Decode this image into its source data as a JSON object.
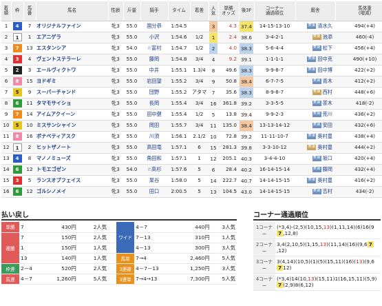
{
  "headers": [
    "着\n順",
    "枠",
    "馬\n番",
    "馬名",
    "性齢",
    "斤量",
    "騎手",
    "タイム",
    "着差",
    "人\n気",
    "単勝\nオッズ",
    "後3F",
    "コーナー\n通過順位",
    "厩舎",
    "馬体重\n(増減)"
  ],
  "frame_colors": {
    "1": "#ffffff",
    "2": "#222222",
    "3": "#e03030",
    "4": "#2a5cc8",
    "5": "#e8c51c",
    "6": "#2f9a3a",
    "7": "#f08a1c",
    "8": "#f08aa8"
  },
  "rows": [
    {
      "rank": "1",
      "waku": "4",
      "num": "7",
      "name": "オリジナルファイン",
      "sex_age": "牝3",
      "weight": "55.0",
      "jockey": "国分恭",
      "time": "1:54.5",
      "margin": "",
      "pop": "3",
      "odds": "4.3",
      "f3": "37.4",
      "corner": "14-15-13-10",
      "stable_tag": "美東",
      "trainer": "清水久",
      "body": "494(+4)"
    },
    {
      "rank": "2",
      "waku": "1",
      "num": "1",
      "name": "エアニゲラ",
      "sex_age": "牝3",
      "weight": "55.0",
      "jockey": "小沢",
      "time": "1:54.6",
      "margin": "1/2",
      "pop": "1",
      "odds": "2.4",
      "f3": "38.6",
      "corner": "3-4-2-1",
      "stable_tag": "美東",
      "trainer": "池添",
      "body": "460(-4)"
    },
    {
      "rank": "3",
      "waku": "7",
      "num": "13",
      "name": "エスタンシア",
      "sex_age": "牝3",
      "weight": "54.0",
      "jockey": "☆富村",
      "time": "1:54.7",
      "margin": "1/2",
      "pop": "2",
      "odds": "4.0",
      "f3": "38.3",
      "corner": "5-6-4-4",
      "stable_tag": "美東",
      "trainer": "松下",
      "body": "456(+4)"
    },
    {
      "rank": "4",
      "waku": "3",
      "num": "4",
      "name": "ヴェントステラーレ",
      "sex_age": "牝3",
      "weight": "55.0",
      "jockey": "藤岡",
      "time": "1:54.8",
      "margin": "3/4",
      "pop": "4",
      "odds": "9.2",
      "f3": "39.1",
      "corner": "1-1-1-1",
      "stable_tag": "美東",
      "trainer": "田中克",
      "body": "490(+10)"
    },
    {
      "rank": "5",
      "waku": "2",
      "num": "3",
      "name": "エールヴィクトワ",
      "sex_age": "牝3",
      "weight": "55.0",
      "jockey": "中井",
      "time": "1:55.1",
      "margin": "1.3/4",
      "pop": "8",
      "odds": "49.6",
      "f3": "38.3",
      "corner": "9-9-8-7",
      "stable_tag": "美東",
      "trainer": "田中博",
      "body": "422(+2)"
    },
    {
      "rank": "6",
      "waku": "8",
      "num": "15",
      "name": "ヨドギミ",
      "sex_age": "牝3",
      "weight": "55.0",
      "jockey": "岩田望",
      "time": "1:55.2",
      "margin": "3/4",
      "pop": "9",
      "odds": "50.8",
      "f3": "38.4",
      "corner": "6-7-7-5",
      "stable_tag": "美東",
      "trainer": "青木",
      "body": "412(+2)"
    },
    {
      "rank": "7",
      "waku": "5",
      "num": "9",
      "name": "スーパーチャンド",
      "sex_age": "牝3",
      "weight": "55.0",
      "jockey": "団野",
      "time": "1:55.2",
      "margin": "アタマ",
      "pop": "7",
      "odds": "35.6",
      "f3": "38.3",
      "corner": "8-9-8-7",
      "stable_tag": "美東",
      "trainer": "西村",
      "body": "448(+6)"
    },
    {
      "rank": "8",
      "waku": "6",
      "num": "11",
      "name": "タマモサイショ",
      "sex_age": "牝3",
      "weight": "55.0",
      "jockey": "長岡",
      "time": "1:55.4",
      "margin": "3/4",
      "pop": "16",
      "odds": "361.8",
      "f3": "39.2",
      "corner": "3-3-5-5",
      "stable_tag": "美東",
      "trainer": "茶木",
      "body": "418(-2)"
    },
    {
      "rank": "9",
      "waku": "7",
      "num": "14",
      "name": "アイムアクイーン",
      "sex_age": "牝3",
      "weight": "55.0",
      "jockey": "田中健",
      "time": "1:55.4",
      "margin": "1/2",
      "pop": "5",
      "odds": "13.8",
      "f3": "39.4",
      "corner": "9-9-2-3",
      "stable_tag": "美東",
      "trainer": "荒川",
      "body": "436(+2)"
    },
    {
      "rank": "10",
      "waku": "5",
      "num": "10",
      "name": "ミスサンシャイン",
      "sex_age": "牝3",
      "weight": "55.0",
      "jockey": "岡田",
      "time": "1:55.7",
      "margin": "3/4",
      "pop": "11",
      "odds": "135.0",
      "f3": "38.4",
      "corner": "13-13-14-12",
      "stable_tag": "美東",
      "trainer": "安田",
      "body": "432(+6)"
    },
    {
      "rank": "11",
      "waku": "8",
      "num": "16",
      "name": "ボナベティアスク",
      "sex_age": "牝3",
      "weight": "55.0",
      "jockey": "川須",
      "time": "1:56.1",
      "margin": "2.1/2",
      "pop": "10",
      "odds": "72.8",
      "f3": "39.2",
      "corner": "11-11-10-7",
      "stable_tag": "美東",
      "trainer": "奥村豊",
      "body": "438(+4)"
    },
    {
      "rank": "12",
      "waku": "1",
      "num": "2",
      "name": "ヒットザノート",
      "sex_age": "牝3",
      "weight": "55.0",
      "jockey": "高田竜",
      "time": "1:57.1",
      "margin": "6",
      "pop": "15",
      "odds": "281.3",
      "f3": "39.8",
      "corner": "3-3-10-12",
      "stable_tag": "美東",
      "trainer": "奥村豊",
      "body": "444(+2)"
    },
    {
      "rank": "13",
      "waku": "4",
      "num": "8",
      "name": "マノノミューズ",
      "sex_age": "牝3",
      "weight": "55.0",
      "jockey": "角田和",
      "time": "1:57.1",
      "margin": "1",
      "pop": "12",
      "odds": "205.1",
      "f3": "40.3",
      "corner": "3-4-4-10",
      "stable_tag": "美東",
      "trainer": "坂口",
      "body": "420(+4)"
    },
    {
      "rank": "14",
      "waku": "6",
      "num": "12",
      "name": "トモエゴゼン",
      "sex_age": "牝3",
      "weight": "54.0",
      "jockey": "☆高杉",
      "time": "1:57.6",
      "margin": "5",
      "pop": "6",
      "odds": "28.4",
      "f3": "40.2",
      "corner": "16-14-15-14",
      "stable_tag": "美東",
      "trainer": "藤岡",
      "body": "432(+4)"
    },
    {
      "rank": "15",
      "waku": "3",
      "num": "5",
      "name": "ランスオブフェイス",
      "sex_age": "牝3",
      "weight": "55.0",
      "jockey": "杲谷",
      "time": "1:58.0",
      "margin": "5",
      "pop": "14",
      "odds": "222.7",
      "f3": "40.7",
      "corner": "14-14-15-15",
      "stable_tag": "美東",
      "trainer": "奥村豊",
      "body": "416(+2)"
    },
    {
      "rank": "16",
      "waku": "6",
      "num": "12",
      "name": "ゴルシノメイ",
      "sex_age": "牝3",
      "weight": "55.0",
      "jockey": "田口",
      "time": "2:00.5",
      "margin": "5",
      "pop": "13",
      "odds": "104.5",
      "f3": "43.0",
      "corner": "14-14-15-15",
      "stable_tag": "美東",
      "trainer": "吉村",
      "body": "434(-2)"
    }
  ],
  "payout_title": "払い戻し",
  "payouts_left": [
    {
      "type": "単勝",
      "color": "#e05a5a",
      "rowspan": 1,
      "combo": "7",
      "amount": "430円",
      "pop": "2人気"
    },
    {
      "type": "複勝",
      "color": "#e05a5a",
      "rowspan": 3,
      "combo": "7",
      "amount": "150円",
      "pop": "2人気"
    },
    {
      "type": "",
      "color": "",
      "rowspan": 0,
      "combo": "1",
      "amount": "150円",
      "pop": "1人気"
    },
    {
      "type": "",
      "color": "",
      "rowspan": 0,
      "combo": "13",
      "amount": "140円",
      "pop": "1人気"
    },
    {
      "type": "枠連",
      "color": "#3a9a5a",
      "rowspan": 1,
      "combo": "2－4",
      "amount": "520円",
      "pop": "2人気"
    },
    {
      "type": "馬連",
      "color": "#e05a5a",
      "rowspan": 1,
      "combo": "4－7",
      "amount": "1,260円",
      "pop": "5人気"
    }
  ],
  "payouts_right": [
    {
      "type": "ワイド",
      "color": "#3a6ab8",
      "rowspan": 3,
      "combo": "4－7",
      "amount": "440円",
      "pop": "3人気"
    },
    {
      "type": "",
      "color": "",
      "rowspan": 0,
      "combo": "7－13",
      "amount": "310円",
      "pop": "1人気"
    },
    {
      "type": "",
      "color": "",
      "rowspan": 0,
      "combo": "4－13",
      "amount": "300円",
      "pop": "3人気"
    },
    {
      "type": "馬単",
      "color": "#e8921c",
      "rowspan": 1,
      "combo": "7→4",
      "amount": "2,460円",
      "pop": "5人気"
    },
    {
      "type": "3連複",
      "color": "#e8921c",
      "rowspan": 1,
      "combo": "4－7－13",
      "amount": "1,250円",
      "pop": "3人気"
    },
    {
      "type": "3連単",
      "color": "#e8921c",
      "rowspan": 1,
      "combo": "7→4→13",
      "amount": "7,300円",
      "pop": "5人気"
    }
  ],
  "corner_title": "コーナー通過順位",
  "corners": [
    {
      "label": "1コーナー",
      "parts": [
        "(*3,4)-(2,5)(10,15,",
        {
          "r": "13"
        },
        ")(1,11,14)(6)16(9",
        {
          "h": "7"
        },
        ",12,8)"
      ]
    },
    {
      "label": "2コーナー",
      "parts": [
        "3,4(2,10,5)(1,15,",
        {
          "r": "13"
        },
        ")(11,14)(16)(9,6",
        {
          "h": "7"
        },
        ",12)"
      ]
    },
    {
      "label": "3コーナー",
      "parts": [
        "3(4,14)(10,5)(1)(5)(15,11)(16)(",
        {
          "r": "13"
        },
        ")(9,6",
        {
          "h": "7"
        },
        "12)"
      ]
    },
    {
      "label": "4コーナー",
      "parts": [
        "(*3,4)14(10,",
        {
          "r": "13"
        },
        ")(15,11)1(16,15,11)(5,9)",
        {
          "h": "7"
        },
        "(2,9)8(6,12)"
      ]
    }
  ]
}
